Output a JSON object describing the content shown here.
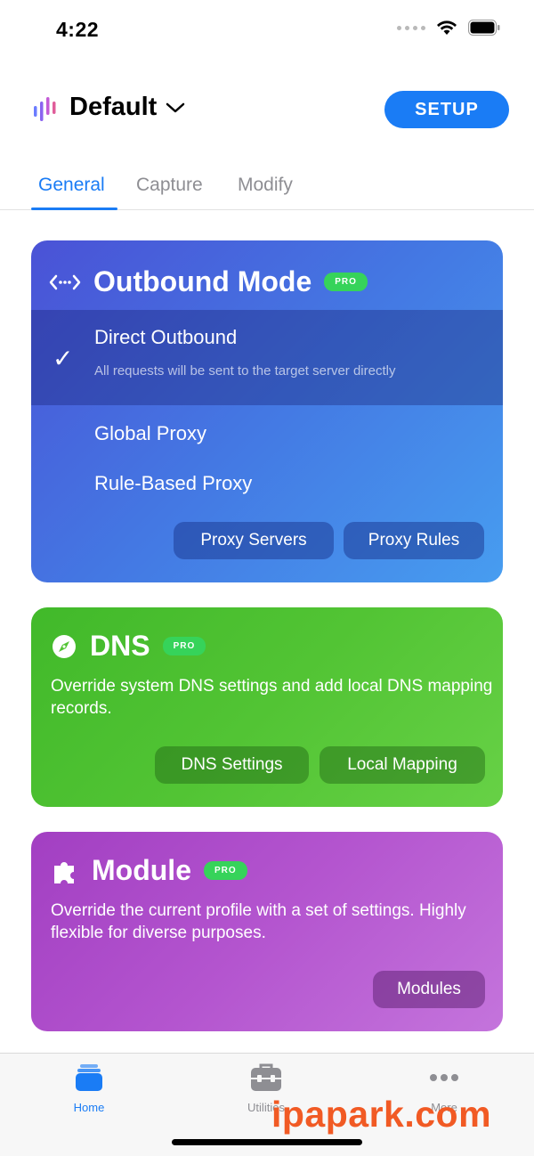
{
  "status": {
    "time": "4:22"
  },
  "header": {
    "profile_name": "Default",
    "setup_label": "SETUP"
  },
  "tabs": [
    {
      "label": "General",
      "active": true
    },
    {
      "label": "Capture",
      "active": false
    },
    {
      "label": "Modify",
      "active": false
    }
  ],
  "outbound": {
    "title": "Outbound Mode",
    "badge": "PRO",
    "options": [
      {
        "label": "Direct Outbound",
        "subtitle": "All requests will be sent to the target server directly",
        "selected": true
      },
      {
        "label": "Global Proxy",
        "selected": false
      },
      {
        "label": "Rule-Based Proxy",
        "selected": false
      }
    ],
    "buttons": [
      "Proxy Servers",
      "Proxy Rules"
    ]
  },
  "dns": {
    "title": "DNS",
    "badge": "PRO",
    "description": "Override system DNS settings and add local DNS mapping records.",
    "buttons": [
      "DNS Settings",
      "Local Mapping"
    ]
  },
  "module": {
    "title": "Module",
    "badge": "PRO",
    "description": "Override the current profile with a set of settings. Highly flexible for diverse purposes.",
    "buttons": [
      "Modules"
    ]
  },
  "tabbar": {
    "items": [
      {
        "label": "Home",
        "icon": "home-stack-icon",
        "active": true
      },
      {
        "label": "Utilities",
        "icon": "toolbox-icon",
        "active": false
      },
      {
        "label": "More",
        "icon": "ellipsis-icon",
        "active": false
      }
    ]
  },
  "watermark": "ipapark.com",
  "colors": {
    "accent": "#1a7cf5",
    "outbound_card": "#4478e3",
    "dns_card": "#52c434",
    "module_card": "#b455cf",
    "pro_badge": "#36d35a",
    "watermark": "#f15a24"
  }
}
